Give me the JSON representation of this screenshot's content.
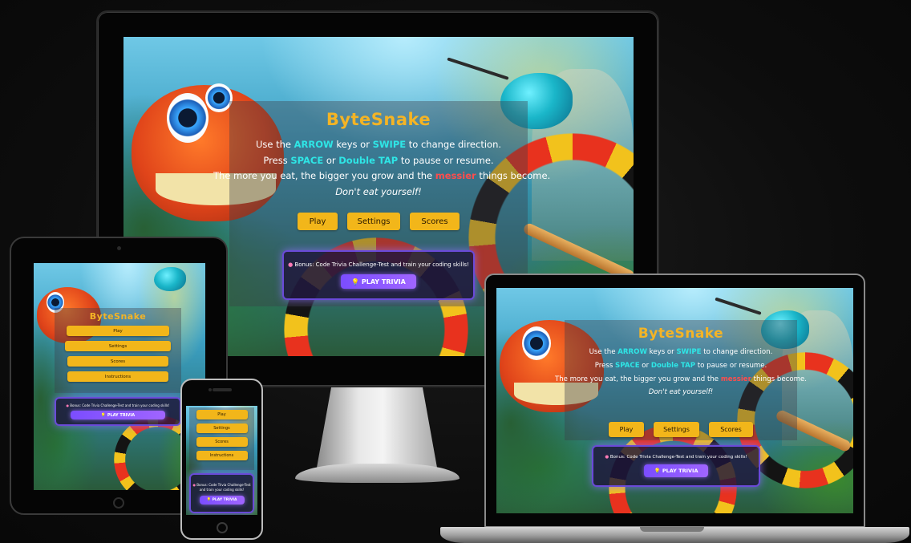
{
  "game": {
    "title": "ByteSnake",
    "instructions": {
      "line1": {
        "pre": "Use the ",
        "kw1": "ARROW",
        "mid": " keys or ",
        "kw2": "SWIPE",
        "post": " to change direction."
      },
      "line2": {
        "pre": "Press ",
        "kw1": "SPACE",
        "mid": " or ",
        "kw2": "Double TAP",
        "post": " to pause or resume."
      },
      "line3": {
        "pre": "The more you eat, the bigger you grow and the ",
        "kw": "messier",
        "post": " things become."
      },
      "line4": "Don't eat yourself!"
    },
    "buttons": {
      "play": "Play",
      "settings": "Settings",
      "scores": "Scores",
      "instructions": "Instructions"
    },
    "trivia": {
      "text": "Bonus: Code Trivia Challenge-Test and train your coding skills!",
      "button": "PLAY TRIVIA",
      "icon": "brain-icon",
      "button_icon": "lightbulb-icon"
    }
  },
  "colors": {
    "title": "#f4b425",
    "keyword": "#2ee6e6",
    "keyword_alert": "#ff4d4d",
    "button": "#f2b61a",
    "trivia_button": "#7b4dff"
  },
  "devices": [
    "desktop-monitor",
    "tablet",
    "phone",
    "laptop"
  ]
}
